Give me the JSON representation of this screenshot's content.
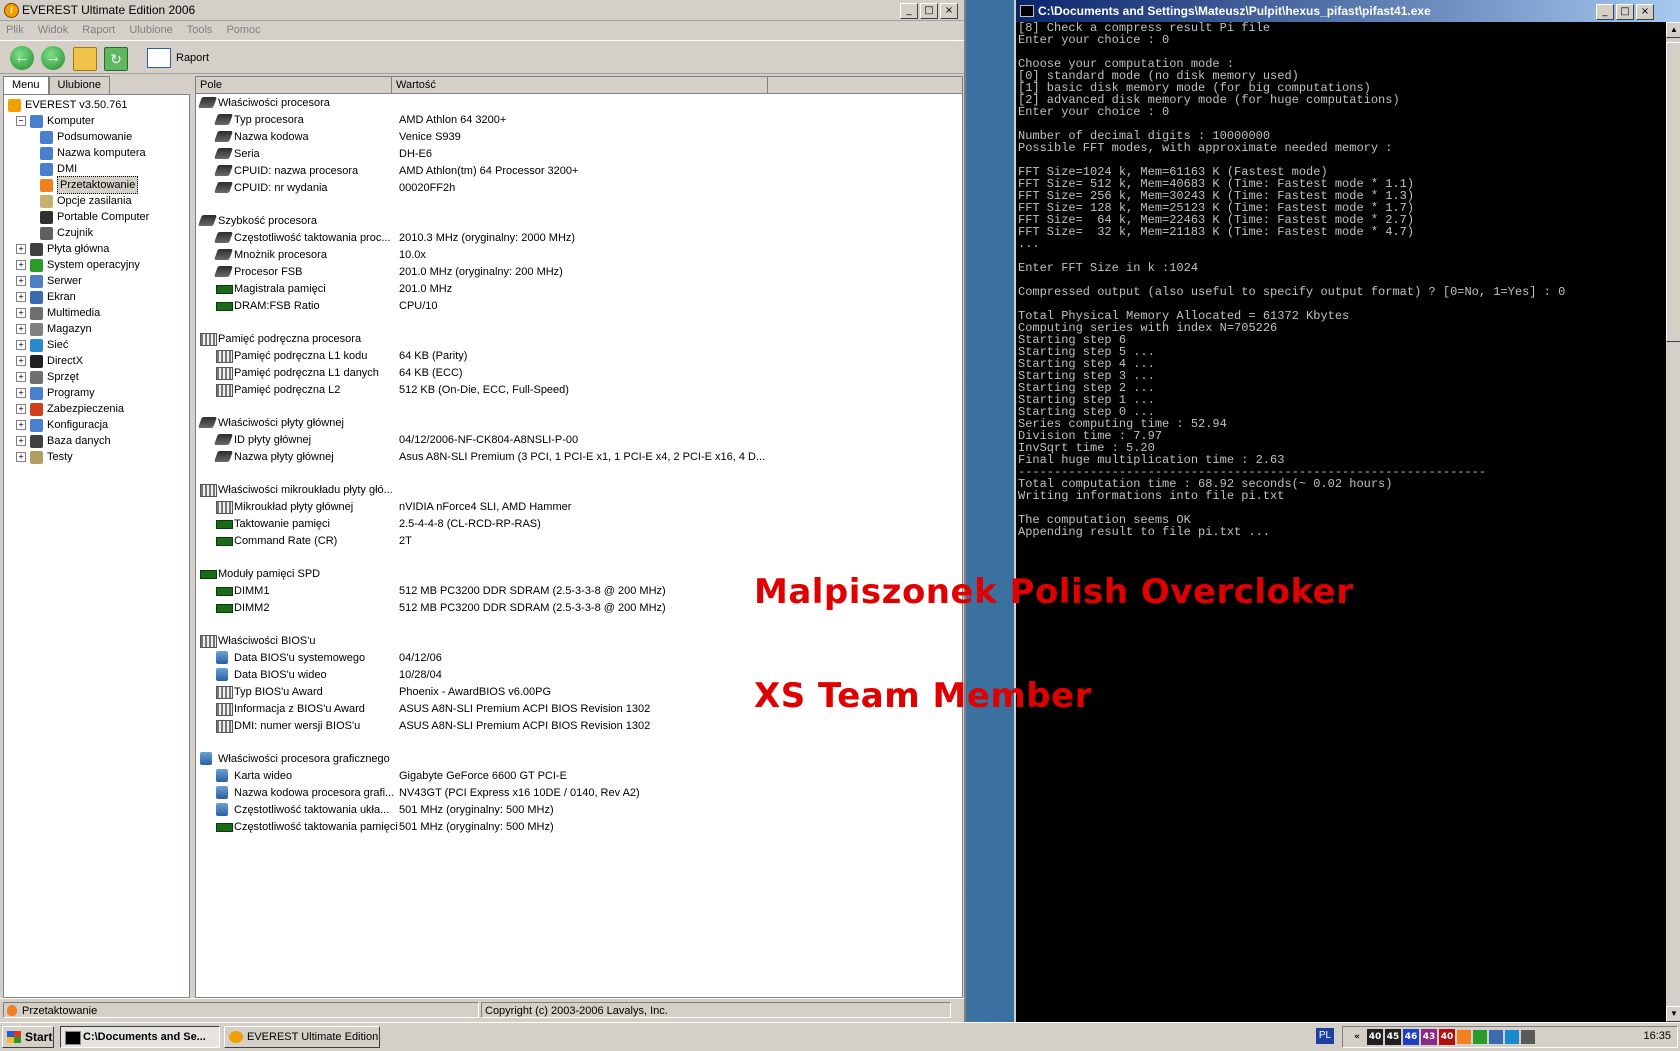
{
  "everest": {
    "title": "EVEREST Ultimate Edition 2006",
    "menu": [
      "Plik",
      "Widok",
      "Raport",
      "Ulubione",
      "Tools",
      "Pomoc"
    ],
    "toolbar": {
      "report_label": "Raport"
    },
    "tabs": [
      "Menu",
      "Ulubione"
    ],
    "tree": [
      {
        "label": "EVEREST v3.50.761",
        "level": 0,
        "expander": "",
        "icon_color": "#f0a000",
        "icon": "info-icon"
      },
      {
        "label": "Komputer",
        "level": 1,
        "expander": "−",
        "icon_color": "#4a7fd0",
        "icon": "computer-icon"
      },
      {
        "label": "Podsumowanie",
        "level": 2,
        "expander": "",
        "icon_color": "#4a7fd0",
        "icon": "summary-icon"
      },
      {
        "label": "Nazwa komputera",
        "level": 2,
        "expander": "",
        "icon_color": "#4a7fd0",
        "icon": "computer-name-icon"
      },
      {
        "label": "DMI",
        "level": 2,
        "expander": "",
        "icon_color": "#4a7fd0",
        "icon": "dmi-icon"
      },
      {
        "label": "Przetaktowanie",
        "level": 2,
        "expander": "",
        "icon_color": "#f08020",
        "icon": "flame-icon",
        "selected": true
      },
      {
        "label": "Opcje zasilania",
        "level": 2,
        "expander": "",
        "icon_color": "#c8b070",
        "icon": "power-icon"
      },
      {
        "label": "Portable Computer",
        "level": 2,
        "expander": "",
        "icon_color": "#303030",
        "icon": "laptop-icon"
      },
      {
        "label": "Czujnik",
        "level": 2,
        "expander": "",
        "icon_color": "#606060",
        "icon": "sensor-icon"
      },
      {
        "label": "Płyta główna",
        "level": 1,
        "expander": "+",
        "icon_color": "#404040",
        "icon": "motherboard-icon"
      },
      {
        "label": "System operacyjny",
        "level": 1,
        "expander": "+",
        "icon_color": "#2a9a2a",
        "icon": "windows-icon"
      },
      {
        "label": "Serwer",
        "level": 1,
        "expander": "+",
        "icon_color": "#5080c0",
        "icon": "server-icon"
      },
      {
        "label": "Ekran",
        "level": 1,
        "expander": "+",
        "icon_color": "#3a6ab0",
        "icon": "monitor-icon"
      },
      {
        "label": "Multimedia",
        "level": 1,
        "expander": "+",
        "icon_color": "#707070",
        "icon": "multimedia-icon"
      },
      {
        "label": "Magazyn",
        "level": 1,
        "expander": "+",
        "icon_color": "#808080",
        "icon": "storage-icon"
      },
      {
        "label": "Sieć",
        "level": 1,
        "expander": "+",
        "icon_color": "#2a8ad0",
        "icon": "network-icon"
      },
      {
        "label": "DirectX",
        "level": 1,
        "expander": "+",
        "icon_color": "#202020",
        "icon": "directx-icon"
      },
      {
        "label": "Sprzęt",
        "level": 1,
        "expander": "+",
        "icon_color": "#707070",
        "icon": "hardware-icon"
      },
      {
        "label": "Programy",
        "level": 1,
        "expander": "+",
        "icon_color": "#4a7fd0",
        "icon": "programs-icon"
      },
      {
        "label": "Zabezpieczenia",
        "level": 1,
        "expander": "+",
        "icon_color": "#d04020",
        "icon": "security-icon"
      },
      {
        "label": "Konfiguracja",
        "level": 1,
        "expander": "+",
        "icon_color": "#4a7fd0",
        "icon": "config-icon"
      },
      {
        "label": "Baza danych",
        "level": 1,
        "expander": "+",
        "icon_color": "#404040",
        "icon": "database-icon"
      },
      {
        "label": "Testy",
        "level": 1,
        "expander": "+",
        "icon_color": "#b0a060",
        "icon": "hourglass-icon"
      }
    ],
    "columns": [
      "Pole",
      "Wartość"
    ],
    "groups": [
      {
        "title": "Właściwości procesora",
        "icon": "cpu",
        "rows": [
          [
            "Typ procesora",
            "AMD Athlon 64 3200+",
            "cpu"
          ],
          [
            "Nazwa kodowa",
            "Venice S939",
            "cpu"
          ],
          [
            "Seria",
            "DH-E6",
            "cpu"
          ],
          [
            "CPUID: nazwa procesora",
            "AMD Athlon(tm) 64 Processor 3200+",
            "cpu"
          ],
          [
            "CPUID: nr wydania",
            "00020FF2h",
            "cpu"
          ]
        ]
      },
      {
        "title": "Szybkość procesora",
        "icon": "cpu",
        "rows": [
          [
            "Częstotliwość taktowania proc...",
            "2010.3 MHz  (oryginalny: 2000 MHz)",
            "cpu"
          ],
          [
            "Mnożnik procesora",
            "10.0x",
            "cpu"
          ],
          [
            "Procesor FSB",
            "201.0 MHz  (oryginalny: 200 MHz)",
            "cpu"
          ],
          [
            "Magistrala pamięci",
            "201.0 MHz",
            "mem"
          ],
          [
            "DRAM:FSB Ratio",
            "CPU/10",
            "mem"
          ]
        ]
      },
      {
        "title": "Pamięć podręczna procesora",
        "icon": "cache",
        "rows": [
          [
            "Pamięć podręczna L1 kodu",
            "64 KB  (Parity)",
            "cache"
          ],
          [
            "Pamięć podręczna L1 danych",
            "64 KB  (ECC)",
            "cache"
          ],
          [
            "Pamięć podręczna L2",
            "512 KB  (On-Die, ECC, Full-Speed)",
            "cache"
          ]
        ]
      },
      {
        "title": "Właściwości płyty głównej",
        "icon": "cpu",
        "rows": [
          [
            "ID płyty głównej",
            "04/12/2006-NF-CK804-A8NSLI-P-00",
            "cpu"
          ],
          [
            "Nazwa płyty głównej",
            "Asus A8N-SLI Premium  (3 PCI, 1 PCI-E x1, 1 PCI-E x4, 2 PCI-E x16, 4 D...",
            "cpu"
          ]
        ]
      },
      {
        "title": "Właściwości mikroukładu płyty głó...",
        "icon": "cache",
        "rows": [
          [
            "Mikroukład płyty głównej",
            "nVIDIA nForce4 SLI, AMD Hammer",
            "cache"
          ],
          [
            "Taktowanie pamięci",
            "2.5-4-4-8  (CL-RCD-RP-RAS)",
            "mem"
          ],
          [
            "Command Rate (CR)",
            "2T",
            "mem"
          ]
        ]
      },
      {
        "title": "Moduły pamięci SPD",
        "icon": "mem",
        "rows": [
          [
            "DIMM1",
            "512 MB PC3200 DDR SDRAM  (2.5-3-3-8 @ 200 MHz)",
            "mem"
          ],
          [
            "DIMM2",
            "512 MB PC3200 DDR SDRAM  (2.5-3-3-8 @ 200 MHz)",
            "mem"
          ]
        ]
      },
      {
        "title": "Właściwości BIOS'u",
        "icon": "cache",
        "rows": [
          [
            "Data BIOS'u systemowego",
            "04/12/06",
            "gpu"
          ],
          [
            "Data BIOS'u wideo",
            "10/28/04",
            "gpu"
          ],
          [
            "Typ BIOS'u Award",
            "Phoenix - AwardBIOS v6.00PG",
            "cache"
          ],
          [
            "Informacja z BIOS'u Award",
            "ASUS A8N-SLI Premium ACPI BIOS Revision 1302",
            "cache"
          ],
          [
            "DMI: numer wersji BIOS'u",
            "ASUS A8N-SLI Premium ACPI BIOS Revision 1302",
            "cache"
          ]
        ]
      },
      {
        "title": "Właściwości procesora graficznego",
        "icon": "gpu",
        "rows": [
          [
            "Karta wideo",
            "Gigabyte GeForce 6600 GT PCI-E",
            "gpu"
          ],
          [
            "Nazwa kodowa procesora grafi...",
            "NV43GT  (PCI Express x16 10DE / 0140, Rev A2)",
            "gpu"
          ],
          [
            "Częstotliwość taktowania ukła...",
            "501 MHz  (oryginalny: 500 MHz)",
            "gpu"
          ],
          [
            "Częstotliwość taktowania pamięci",
            "501 MHz  (oryginalny: 500 MHz)",
            "mem"
          ]
        ]
      }
    ],
    "status": {
      "left": "Przetaktowanie",
      "right": "Copyright (c) 2003-2006 Lavalys, Inc."
    }
  },
  "console": {
    "title": "C:\\Documents and Settings\\Mateusz\\Pulpit\\hexus_pifast\\pifast41.exe",
    "lines": [
      "[8] Check a compress result Pi file",
      "Enter your choice : 0",
      "",
      "Choose your computation mode :",
      "[0] standard mode (no disk memory used)",
      "[1] basic disk memory mode (for big computations)",
      "[2] advanced disk memory mode (for huge computations)",
      "Enter your choice : 0",
      "",
      "Number of decimal digits : 10000000",
      "Possible FFT modes, with approximate needed memory :",
      "",
      "FFT Size=1024 k, Mem=61163 K (Fastest mode)",
      "FFT Size= 512 k, Mem=40683 K (Time: Fastest mode * 1.1)",
      "FFT Size= 256 k, Mem=30243 K (Time: Fastest mode * 1.3)",
      "FFT Size= 128 k, Mem=25123 K (Time: Fastest mode * 1.7)",
      "FFT Size=  64 k, Mem=22463 K (Time: Fastest mode * 2.7)",
      "FFT Size=  32 k, Mem=21183 K (Time: Fastest mode * 4.7)",
      "...",
      "",
      "Enter FFT Size in k :1024",
      "",
      "Compressed output (also useful to specify output format) ? [0=No, 1=Yes] : 0",
      "",
      "Total Physical Memory Allocated = 61372 Kbytes",
      "Computing series with index N=705226",
      "Starting step 6",
      "Starting step 5 ...",
      "Starting step 4 ...",
      "Starting step 3 ...",
      "Starting step 2 ...",
      "Starting step 1 ...",
      "Starting step 0 ...",
      "Series computing time : 52.94",
      "Division time : 7.97",
      "InvSqrt time : 5.20",
      "Final huge multiplication time : 2.63",
      "-----------------------------------------------------------------",
      "Total computation time : 68.92 seconds(~ 0.02 hours)",
      "Writing informations into file pi.txt",
      "",
      "The computation seems OK",
      "Appending result to file pi.txt ..."
    ]
  },
  "watermark": {
    "line1": "Malpiszonek Polish Overcloker",
    "line2": "XS Team Member"
  },
  "taskbar": {
    "start_label": "Start",
    "tasks": [
      "C:\\Documents and Se...",
      "EVEREST Ultimate Edition"
    ],
    "lang": "PL",
    "tray": [
      {
        "text": "«",
        "color": "#d4d0c8",
        "fg": "#000"
      },
      {
        "text": "40",
        "color": "#202020",
        "fg": "#fff"
      },
      {
        "text": "45",
        "color": "#202020",
        "fg": "#fff"
      },
      {
        "text": "46",
        "color": "#1e40c0",
        "fg": "#fff"
      },
      {
        "text": "43",
        "color": "#8a2a8a",
        "fg": "#fff"
      },
      {
        "text": "40",
        "color": "#b01010",
        "fg": "#fff"
      }
    ],
    "clock": "16:35"
  }
}
